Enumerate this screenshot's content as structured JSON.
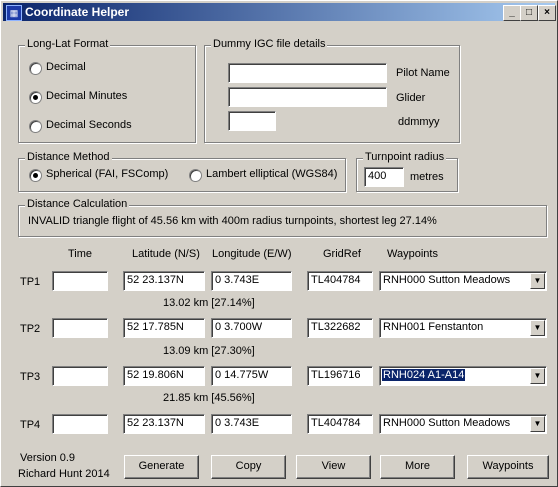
{
  "window": {
    "title": "Coordinate Helper",
    "icon": "app-icon",
    "controls": {
      "minimize": "_",
      "maximize": "□",
      "close": "×"
    }
  },
  "format_group": {
    "legend": "Long-Lat Format",
    "options": [
      "Decimal",
      "Decimal Minutes",
      "Decimal Seconds"
    ],
    "selected": "Decimal Minutes"
  },
  "igc_group": {
    "legend": "Dummy IGC file details",
    "pilot_name_label": "Pilot Name",
    "pilot_name_value": "",
    "glider_label": "Glider",
    "glider_value": "",
    "date_label": "ddmmyy",
    "date_value": ""
  },
  "distance_method": {
    "legend": "Distance Method",
    "options": [
      "Spherical (FAI, FSComp)",
      "Lambert elliptical (WGS84)"
    ],
    "selected": "Spherical (FAI, FSComp)"
  },
  "turnpoint_radius": {
    "legend": "Turnpoint radius",
    "value": "400",
    "unit": "metres"
  },
  "distance_calc": {
    "legend": "Distance Calculation",
    "result": "INVALID triangle flight of 45.56 km with 400m radius turnpoints, shortest leg 27.14%"
  },
  "table": {
    "headers": {
      "time": "Time",
      "lat": "Latitude (N/S)",
      "lon": "Longitude (E/W)",
      "grid": "GridRef",
      "waypoint": "Waypoints"
    },
    "rows": [
      {
        "label": "TP1",
        "time": "",
        "lat": "52 23.137N",
        "lon": "0 3.743E",
        "grid": "TL404784",
        "waypoint": "RNH000 Sutton Meadows"
      },
      {
        "label": "TP2",
        "time": "",
        "lat": "52 17.785N",
        "lon": "0 3.700W",
        "grid": "TL322682",
        "waypoint": "RNH001 Fenstanton"
      },
      {
        "label": "TP3",
        "time": "",
        "lat": "52 19.806N",
        "lon": "0 14.775W",
        "grid": "TL196716",
        "waypoint": "RNH024 A1-A14"
      },
      {
        "label": "TP4",
        "time": "",
        "lat": "52 23.137N",
        "lon": "0 3.743E",
        "grid": "TL404784",
        "waypoint": "RNH000 Sutton Meadows"
      }
    ],
    "legs": [
      "13.02 km [27.14%]",
      "13.09 km [27.30%]",
      "21.85 km [45.56%]"
    ]
  },
  "footer": {
    "version": "Version 0.9",
    "author": "Richard Hunt 2014",
    "buttons": [
      "Generate",
      "Copy",
      "View",
      "More",
      "Waypoints"
    ]
  }
}
